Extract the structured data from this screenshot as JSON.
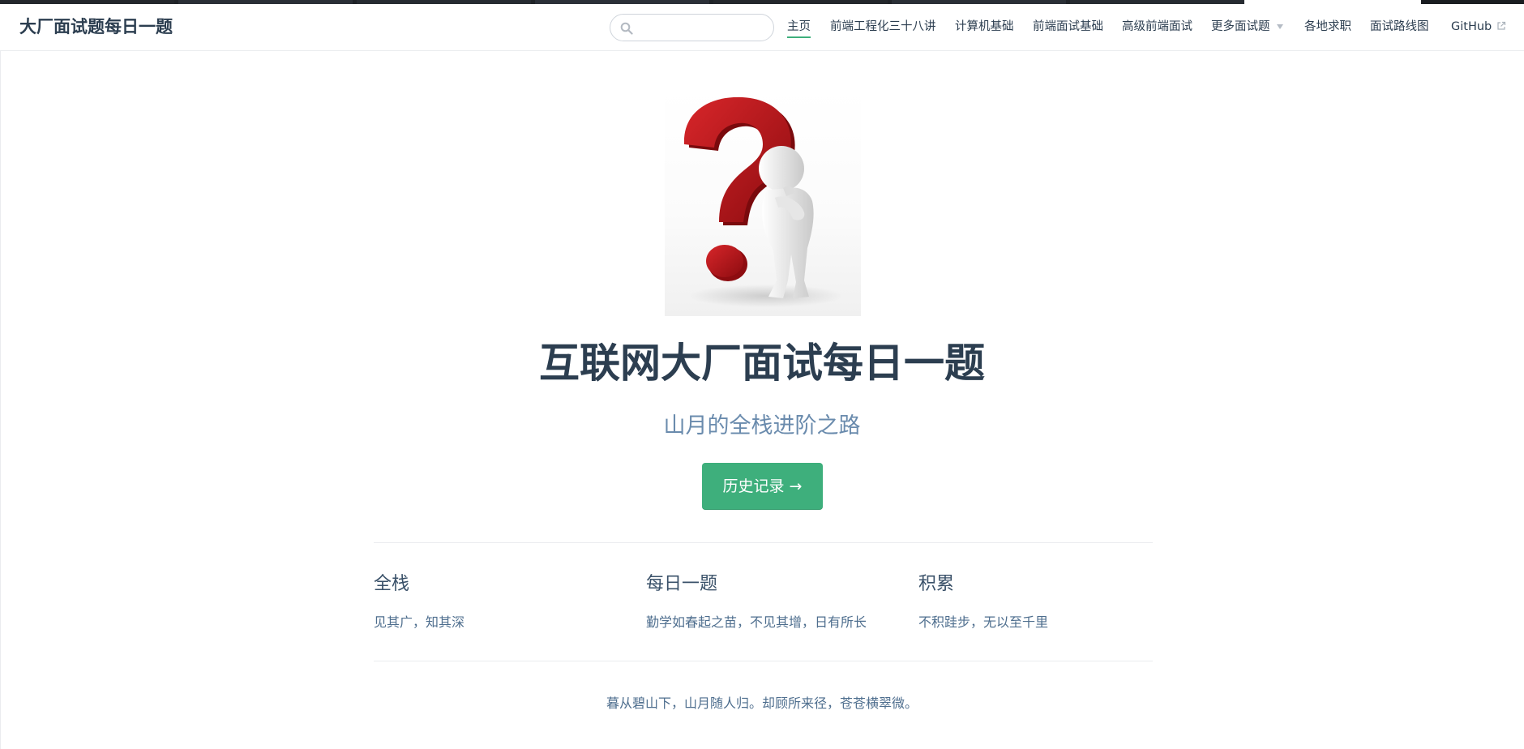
{
  "navbar": {
    "site_name": "大厂面试题每日一题",
    "search": {
      "value": "",
      "placeholder": ""
    },
    "links": [
      {
        "label": "主页",
        "active": true
      },
      {
        "label": "前端工程化三十八讲"
      },
      {
        "label": "计算机基础"
      },
      {
        "label": "前端面试基础"
      },
      {
        "label": "高级前端面试"
      },
      {
        "label": "更多面试题",
        "dropdown": true
      },
      {
        "label": "各地求职"
      },
      {
        "label": "面试路线图"
      },
      {
        "label": "GitHub",
        "external": true
      }
    ]
  },
  "hero": {
    "image_icon": "question-mark-figure-icon",
    "title": "互联网大厂面试每日一题",
    "description": "山月的全栈进阶之路",
    "action_label": "历史记录 →"
  },
  "features": [
    {
      "title": "全栈",
      "details": "见其广，知其深"
    },
    {
      "title": "每日一题",
      "details": "勤学如春起之苗，不见其增，日有所长"
    },
    {
      "title": "积累",
      "details": "不积跬步，无以至千里"
    }
  ],
  "footer": {
    "text": "暮从碧山下，山月随人归。却顾所来径，苍苍横翠微。"
  },
  "colors": {
    "accent": "#3eaf7c",
    "text": "#2c3e50",
    "muted": "#6a8bad",
    "question_red": "#c4161c"
  }
}
